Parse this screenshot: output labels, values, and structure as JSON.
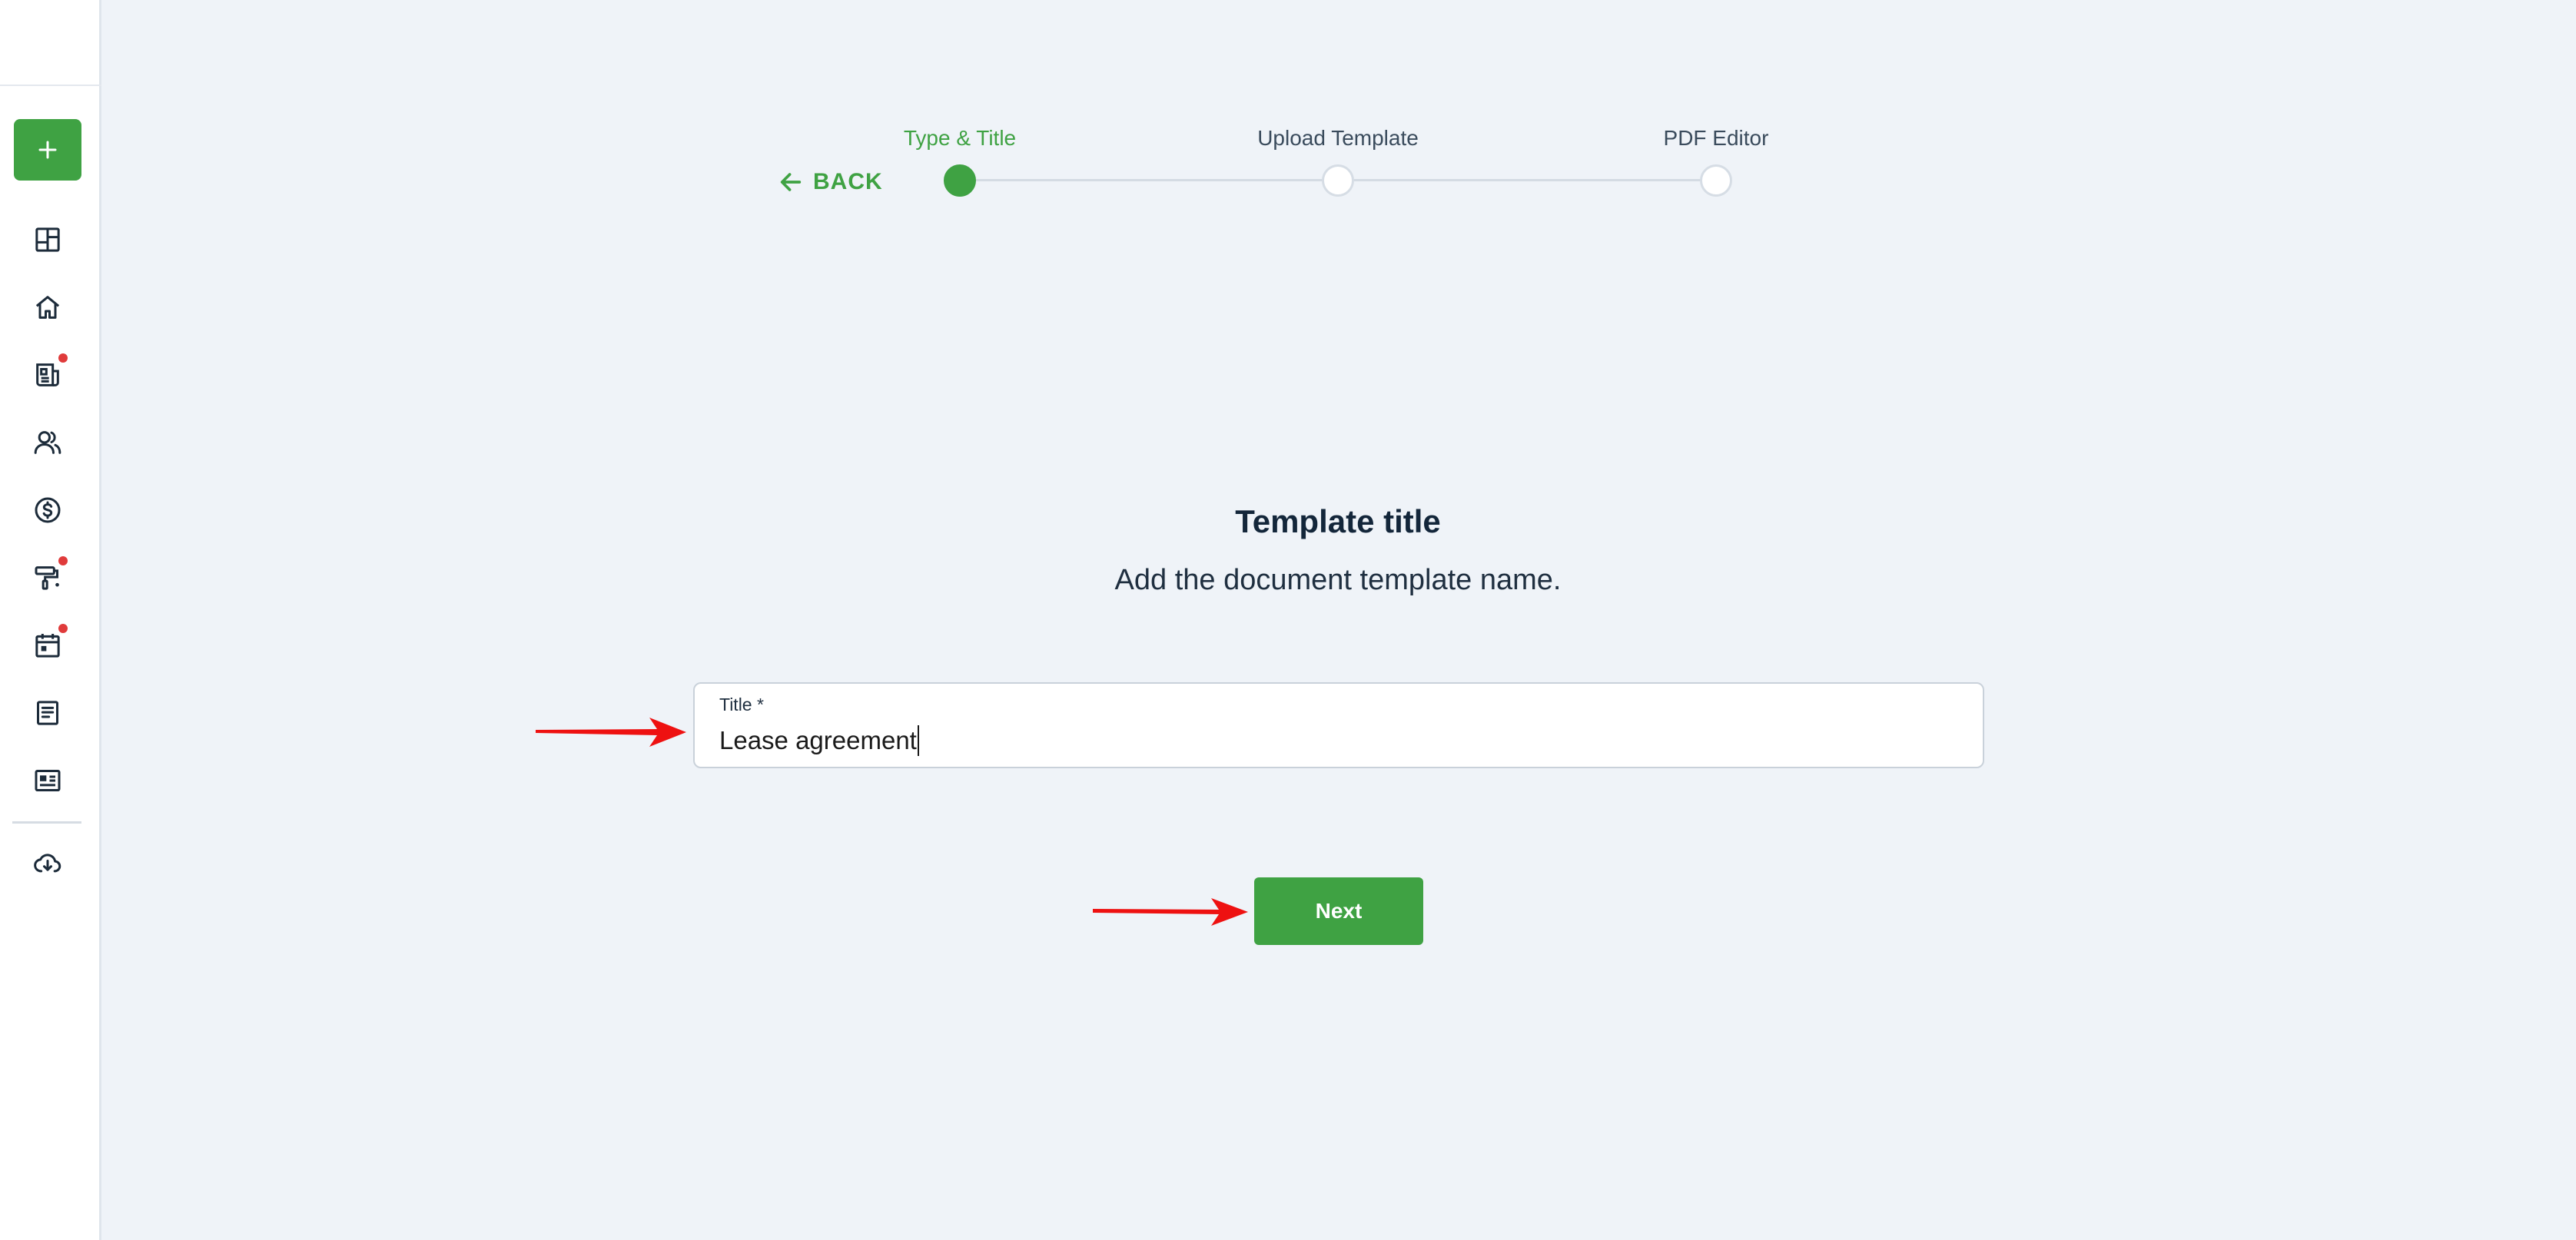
{
  "colors": {
    "accent": "#3fa243",
    "background": "#eff3f8",
    "notification_dot": "#e03b3b",
    "annotation_arrow": "#ee1111"
  },
  "sidebar": {
    "create_icon": "plus-icon",
    "items": [
      {
        "icon": "dashboard-icon",
        "badge": false
      },
      {
        "icon": "home-icon",
        "badge": false
      },
      {
        "icon": "documents-icon",
        "badge": true
      },
      {
        "icon": "users-icon",
        "badge": false
      },
      {
        "icon": "dollar-icon",
        "badge": false
      },
      {
        "icon": "paint-roller-icon",
        "badge": true
      },
      {
        "icon": "calendar-icon",
        "badge": true
      },
      {
        "icon": "file-text-icon",
        "badge": false
      },
      {
        "icon": "id-card-icon",
        "badge": false
      },
      {
        "icon": "cloud-download-icon",
        "badge": false
      }
    ]
  },
  "stepper": {
    "back_label": "BACK",
    "steps": [
      {
        "label": "Type & Title",
        "active": true
      },
      {
        "label": "Upload Template",
        "active": false
      },
      {
        "label": "PDF Editor",
        "active": false
      }
    ]
  },
  "main": {
    "heading": "Template title",
    "subheading": "Add the document template name.",
    "title_field": {
      "label": "Title *",
      "value": "Lease agreement"
    },
    "next_label": "Next"
  }
}
